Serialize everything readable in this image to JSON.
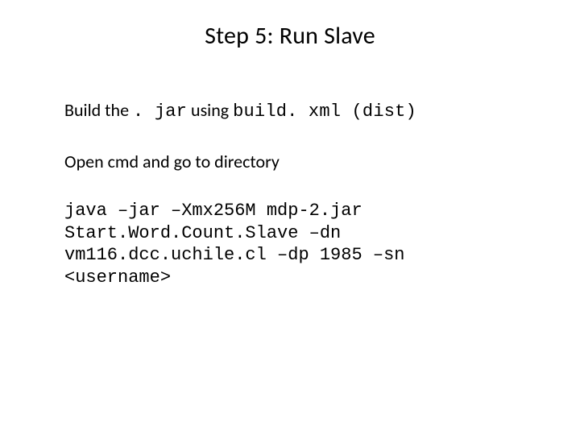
{
  "title": "Step 5: Run Slave",
  "line1": {
    "a": "Build the ",
    "jar": ". jar",
    "b": " using ",
    "build": "build. xml (dist)"
  },
  "line2": "Open cmd and go to directory",
  "cmd": "java –jar –Xmx256M mdp-2.jar Start.Word.Count.Slave –dn vm116.dcc.uchile.cl –dp 1985 –sn <username>"
}
